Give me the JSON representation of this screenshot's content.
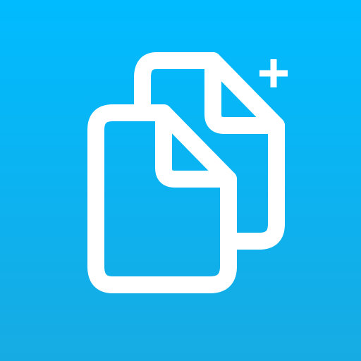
{
  "icon": {
    "name": "duplicate-files-plus-icon",
    "background_top": "#00BBFF",
    "background_bottom": "#17ABE3",
    "glyph_color": "#FFFFFF"
  }
}
